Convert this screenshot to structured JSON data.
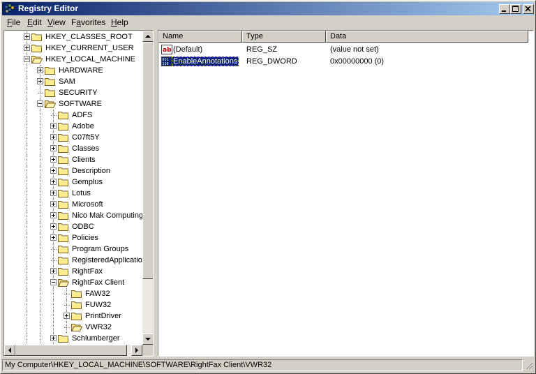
{
  "window": {
    "title": "Registry Editor"
  },
  "menu": [
    {
      "accel": "F",
      "rest": "ile"
    },
    {
      "accel": "E",
      "rest": "dit"
    },
    {
      "accel": "V",
      "rest": "iew"
    },
    {
      "pre": "F",
      "accel": "a",
      "rest": "vorites"
    },
    {
      "accel": "H",
      "rest": "elp"
    }
  ],
  "tree": [
    {
      "label": "HKEY_CLASSES_ROOT",
      "level": 0,
      "expander": "plus"
    },
    {
      "label": "HKEY_CURRENT_USER",
      "level": 0,
      "expander": "plus"
    },
    {
      "label": "HKEY_LOCAL_MACHINE",
      "level": 0,
      "expander": "minus",
      "open": true
    },
    {
      "label": "HARDWARE",
      "level": 1,
      "expander": "plus"
    },
    {
      "label": "SAM",
      "level": 1,
      "expander": "plus"
    },
    {
      "label": "SECURITY",
      "level": 1,
      "expander": "none"
    },
    {
      "label": "SOFTWARE",
      "level": 1,
      "expander": "minus",
      "open": true
    },
    {
      "label": "ADFS",
      "level": 2,
      "expander": "none"
    },
    {
      "label": "Adobe",
      "level": 2,
      "expander": "plus"
    },
    {
      "label": "C07ft5Y",
      "level": 2,
      "expander": "plus"
    },
    {
      "label": "Classes",
      "level": 2,
      "expander": "plus"
    },
    {
      "label": "Clients",
      "level": 2,
      "expander": "plus"
    },
    {
      "label": "Description",
      "level": 2,
      "expander": "plus"
    },
    {
      "label": "Gemplus",
      "level": 2,
      "expander": "plus"
    },
    {
      "label": "Lotus",
      "level": 2,
      "expander": "plus"
    },
    {
      "label": "Microsoft",
      "level": 2,
      "expander": "plus"
    },
    {
      "label": "Nico Mak Computing",
      "level": 2,
      "expander": "plus"
    },
    {
      "label": "ODBC",
      "level": 2,
      "expander": "plus"
    },
    {
      "label": "Policies",
      "level": 2,
      "expander": "plus"
    },
    {
      "label": "Program Groups",
      "level": 2,
      "expander": "none"
    },
    {
      "label": "RegisteredApplications",
      "level": 2,
      "expander": "none"
    },
    {
      "label": "RightFax",
      "level": 2,
      "expander": "plus"
    },
    {
      "label": "RightFax Client",
      "level": 2,
      "expander": "minus",
      "open": true
    },
    {
      "label": "FAW32",
      "level": 3,
      "expander": "none"
    },
    {
      "label": "FUW32",
      "level": 3,
      "expander": "none"
    },
    {
      "label": "PrintDriver",
      "level": 3,
      "expander": "plus"
    },
    {
      "label": "VWR32",
      "level": 3,
      "expander": "none",
      "open": true
    },
    {
      "label": "Schlumberger",
      "level": 2,
      "expander": "plus"
    }
  ],
  "list": {
    "columns": [
      "Name",
      "Type",
      "Data"
    ],
    "rows": [
      {
        "name": "(Default)",
        "type": "REG_SZ",
        "data": "(value not set)",
        "icon": "string-value-icon",
        "selected": false
      },
      {
        "name": "EnableAnnotations",
        "type": "REG_DWORD",
        "data": "0x00000000 (0)",
        "icon": "binary-value-icon",
        "selected": true
      }
    ]
  },
  "statusbar": {
    "path": "My Computer\\HKEY_LOCAL_MACHINE\\SOFTWARE\\RightFax Client\\VWR32"
  },
  "colors": {
    "titlebar_start": "#0a246a",
    "titlebar_end": "#a6caf0",
    "face": "#d4d0c8",
    "selection": "#0a246a"
  }
}
